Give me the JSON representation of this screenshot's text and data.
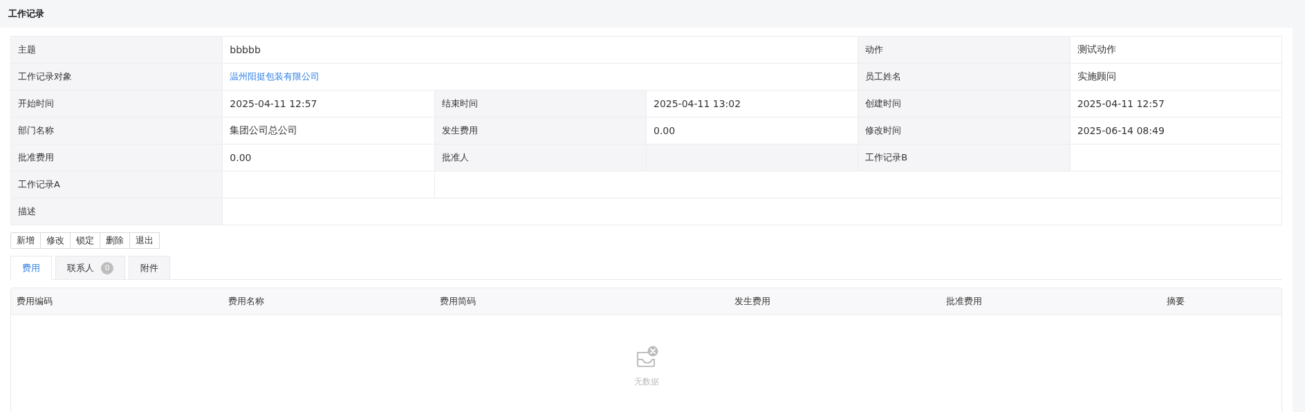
{
  "page_title": "工作记录",
  "form_rows": [
    {
      "cells": [
        {
          "kind": "label",
          "text": "主题"
        },
        {
          "kind": "value",
          "text": "bbbbb"
        },
        {
          "kind": "label",
          "text": "动作"
        },
        {
          "kind": "value",
          "text": "测试动作"
        }
      ]
    },
    {
      "cells": [
        {
          "kind": "label",
          "text": "工作记录对象"
        },
        {
          "kind": "link",
          "text": "温州阳挺包装有限公司"
        },
        {
          "kind": "label",
          "text": "员工姓名"
        },
        {
          "kind": "value",
          "text": "实施顾问"
        }
      ]
    },
    {
      "cells": [
        {
          "kind": "label",
          "text": "开始时间"
        },
        {
          "kind": "value",
          "text": "2025-04-11 12:57"
        },
        {
          "kind": "label",
          "text": "结束时间"
        },
        {
          "kind": "value",
          "text": "2025-04-11 13:02"
        },
        {
          "kind": "label",
          "text": "创建时间"
        },
        {
          "kind": "value",
          "text": "2025-04-11 12:57"
        }
      ]
    },
    {
      "cells": [
        {
          "kind": "label",
          "text": "部门名称"
        },
        {
          "kind": "value",
          "text": "集团公司总公司"
        },
        {
          "kind": "label",
          "text": "发生费用"
        },
        {
          "kind": "value",
          "text": "0.00"
        },
        {
          "kind": "label",
          "text": "修改时间"
        },
        {
          "kind": "value",
          "text": "2025-06-14 08:49"
        }
      ]
    },
    {
      "cells": [
        {
          "kind": "label",
          "text": "批准费用"
        },
        {
          "kind": "value",
          "text": "0.00"
        },
        {
          "kind": "label",
          "text": "批准人"
        },
        {
          "kind": "label"
        },
        {
          "kind": "label",
          "text": "工作记录B"
        },
        {
          "kind": "value"
        }
      ]
    },
    {
      "cells": [
        {
          "kind": "label",
          "text": "工作记录A"
        },
        {
          "kind": "value"
        },
        {
          "kind": "value"
        }
      ]
    },
    {
      "cells": [
        {
          "kind": "label",
          "text": "描述"
        },
        {
          "kind": "value"
        }
      ]
    }
  ],
  "buttons": [
    "新增",
    "修改",
    "锁定",
    "删除",
    "退出"
  ],
  "tabs": [
    {
      "label": "费用",
      "selected": true
    },
    {
      "label": "联系人",
      "badge": "0",
      "selected": false
    },
    {
      "label": "附件",
      "selected": false
    }
  ],
  "table": {
    "columns": [
      {
        "label": "费用编码"
      },
      {
        "label": "费用名称"
      },
      {
        "label": "费用简码"
      },
      {
        "label": "发生费用"
      },
      {
        "label": "批准费用"
      },
      {
        "label": "摘要"
      }
    ],
    "empty_text": "无数据"
  }
}
